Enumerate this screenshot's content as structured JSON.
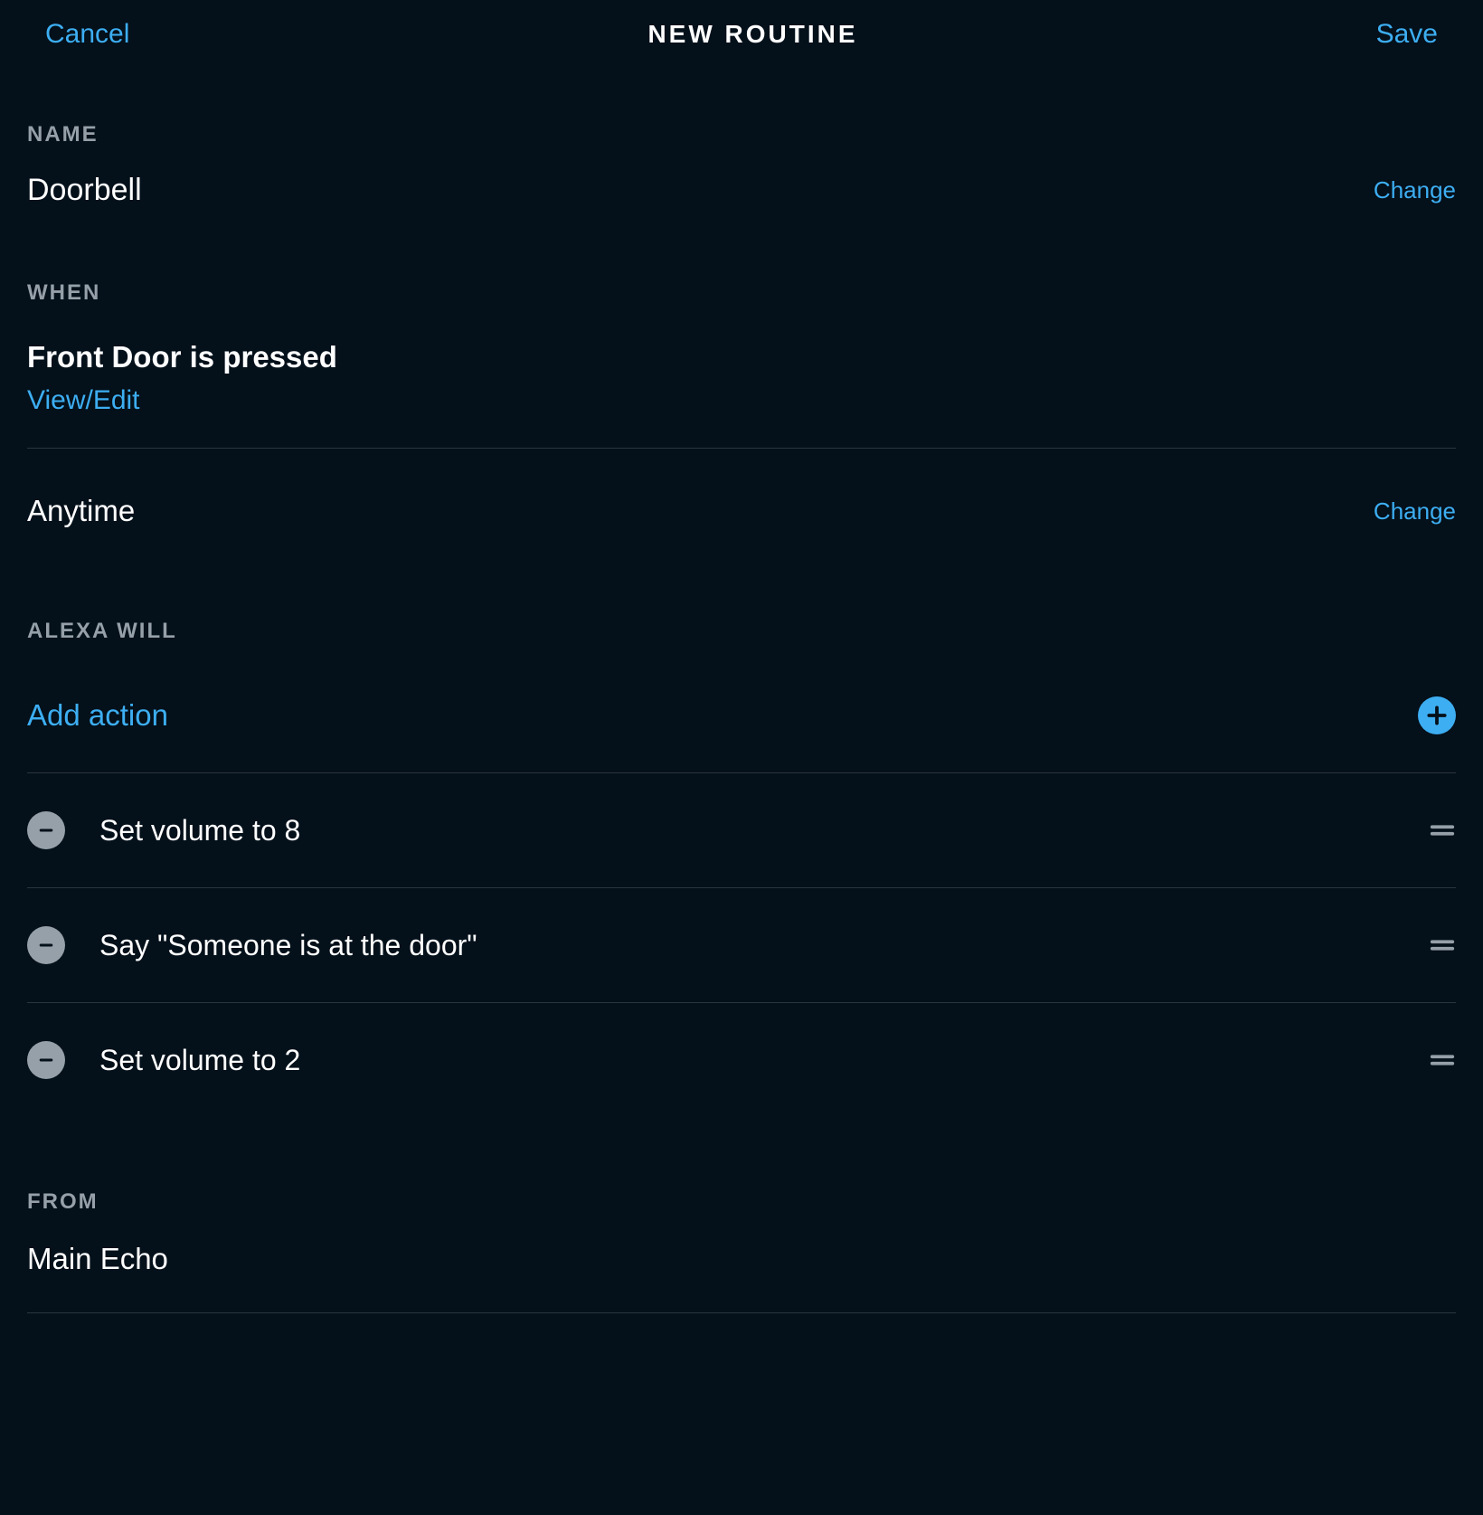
{
  "header": {
    "cancel": "Cancel",
    "title": "NEW ROUTINE",
    "save": "Save"
  },
  "name_section": {
    "label": "NAME",
    "value": "Doorbell",
    "change": "Change"
  },
  "when_section": {
    "label": "WHEN",
    "trigger": "Front Door is pressed",
    "view_edit": "View/Edit",
    "schedule": "Anytime",
    "change": "Change"
  },
  "actions_section": {
    "label": "ALEXA WILL",
    "add_action": "Add action",
    "actions": [
      {
        "text": "Set volume to 8"
      },
      {
        "text": "Say \"Someone is at the door\""
      },
      {
        "text": "Set volume to 2"
      }
    ]
  },
  "from_section": {
    "label": "FROM",
    "device": "Main Echo"
  }
}
